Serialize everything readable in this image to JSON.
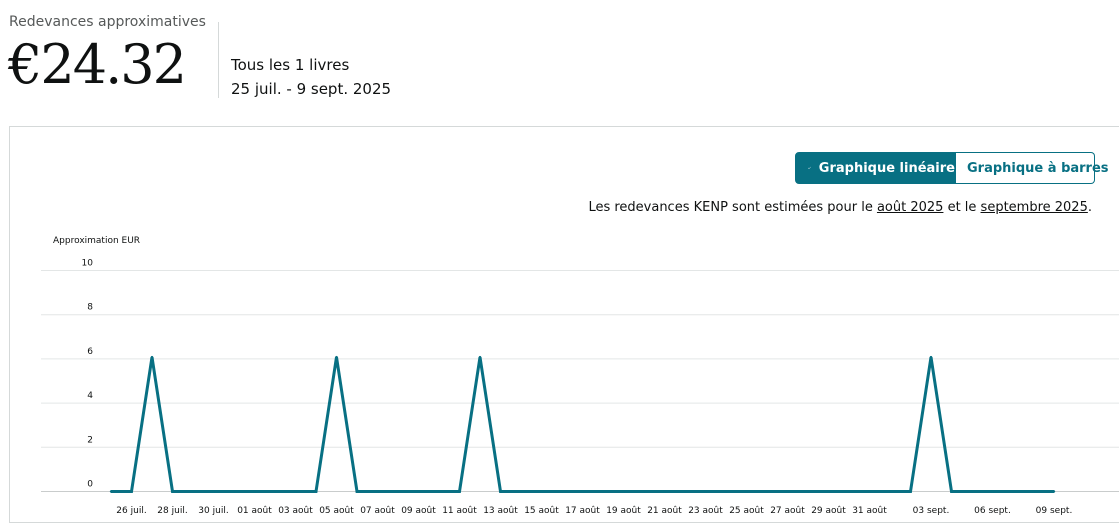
{
  "summary": {
    "label": "Redevances approximatives",
    "amount": "€24.32",
    "books": "Tous les 1 livres",
    "date_range": "25 juil. - 9 sept. 2025"
  },
  "toggle": {
    "line_label": "Graphique linéaire",
    "bar_label": "Graphique à barres",
    "active": "line",
    "check_icon": "checkmark-icon"
  },
  "kenp_note": {
    "prefix": "Les redevances KENP sont estimées pour le ",
    "link1": "août 2025",
    "middle": " et le ",
    "link2": "septembre 2025",
    "suffix": "."
  },
  "colors": {
    "accent": "#087083",
    "grid": "#e3e6e6",
    "text_muted": "#565959"
  },
  "chart_data": {
    "type": "line",
    "ylabel": "Approximation EUR",
    "ylim": [
      0,
      10
    ],
    "yticks": [
      0,
      2,
      4,
      6,
      8,
      10
    ],
    "grid": true,
    "x_tick_labels": [
      "26 juil.",
      "28 juil.",
      "30 juil.",
      "01 août",
      "03 août",
      "05 août",
      "07 août",
      "09 août",
      "11 août",
      "13 août",
      "15 août",
      "17 août",
      "19 août",
      "21 août",
      "23 août",
      "25 août",
      "27 août",
      "29 août",
      "31 août",
      "03 sept.",
      "06 sept.",
      "09 sept."
    ],
    "x": [
      "25 juil.",
      "26 juil.",
      "27 juil.",
      "28 juil.",
      "29 juil.",
      "30 juil.",
      "31 juil.",
      "01 août",
      "02 août",
      "03 août",
      "04 août",
      "05 août",
      "06 août",
      "07 août",
      "08 août",
      "09 août",
      "10 août",
      "11 août",
      "12 août",
      "13 août",
      "14 août",
      "15 août",
      "16 août",
      "17 août",
      "18 août",
      "19 août",
      "20 août",
      "21 août",
      "22 août",
      "23 août",
      "24 août",
      "25 août",
      "26 août",
      "27 août",
      "28 août",
      "29 août",
      "30 août",
      "31 août",
      "01 sept.",
      "02 sept.",
      "03 sept.",
      "04 sept.",
      "05 sept.",
      "06 sept.",
      "07 sept.",
      "08 sept.",
      "09 sept."
    ],
    "series": [
      {
        "values": [
          0,
          0,
          6.08,
          0,
          0,
          0,
          0,
          0,
          0,
          0,
          0,
          6.08,
          0,
          0,
          0,
          0,
          0,
          0,
          6.08,
          0,
          0,
          0,
          0,
          0,
          0,
          0,
          0,
          0,
          0,
          0,
          0,
          0,
          0,
          0,
          0,
          0,
          0,
          0,
          0,
          0,
          6.08,
          0,
          0,
          0,
          0,
          0,
          0
        ]
      }
    ]
  }
}
